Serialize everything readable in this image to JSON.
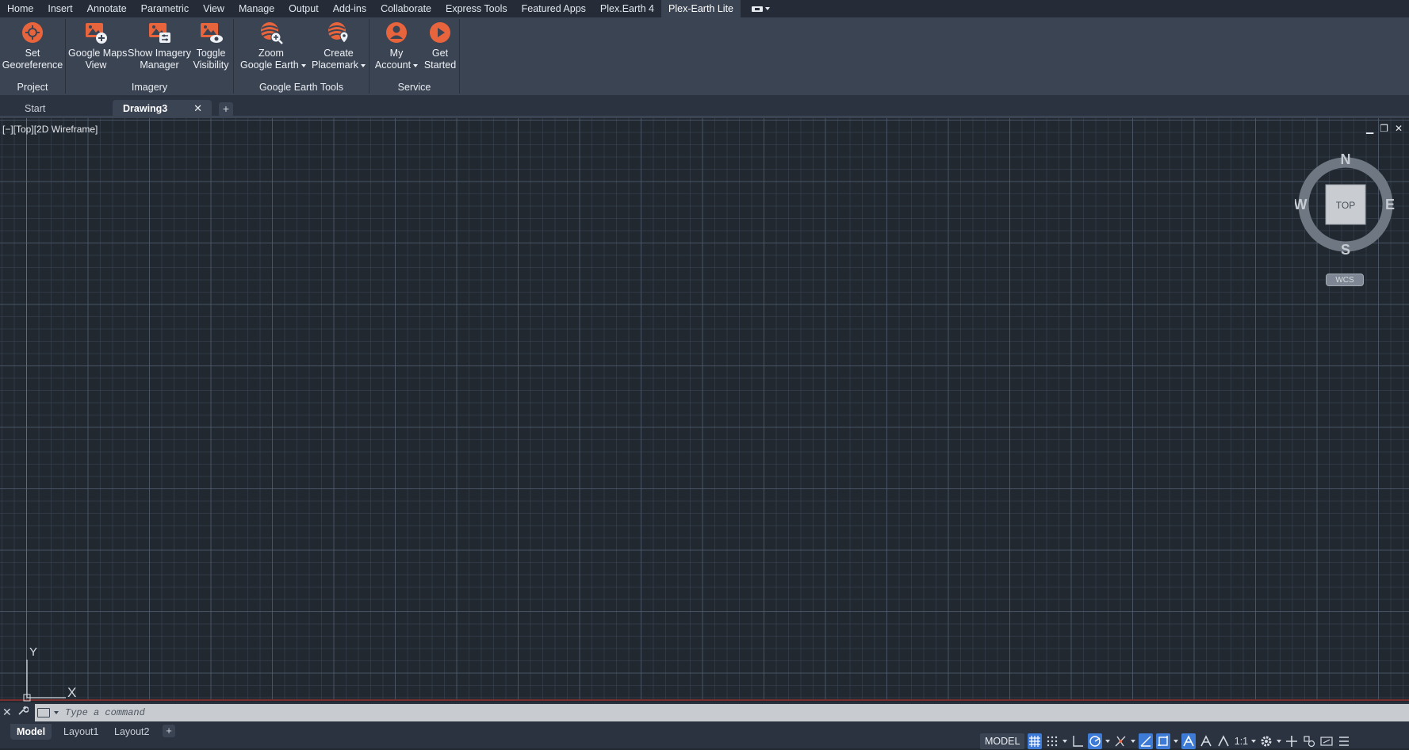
{
  "ribbon": {
    "tabs": [
      {
        "label": "Home",
        "active": false
      },
      {
        "label": "Insert",
        "active": false
      },
      {
        "label": "Annotate",
        "active": false
      },
      {
        "label": "Parametric",
        "active": false
      },
      {
        "label": "View",
        "active": false
      },
      {
        "label": "Manage",
        "active": false
      },
      {
        "label": "Output",
        "active": false
      },
      {
        "label": "Add-ins",
        "active": false
      },
      {
        "label": "Collaborate",
        "active": false
      },
      {
        "label": "Express Tools",
        "active": false
      },
      {
        "label": "Featured Apps",
        "active": false
      },
      {
        "label": "Plex.Earth 4",
        "active": false
      },
      {
        "label": "Plex-Earth Lite",
        "active": true
      }
    ],
    "groups": {
      "project": {
        "title": "Project",
        "set_georeference": "Set\nGeoreference"
      },
      "imagery": {
        "title": "Imagery",
        "google_maps_view": "Google Maps\nView",
        "show_imagery_manager": "Show Imagery\nManager",
        "toggle_visibility": "Toggle\nVisibility"
      },
      "google_earth_tools": {
        "title": "Google Earth Tools",
        "zoom_google_earth": "Zoom\nGoogle Earth",
        "create_placemark": "Create\nPlacemark"
      },
      "service": {
        "title": "Service",
        "my_account": "My\nAccount",
        "get_started": "Get\nStarted"
      }
    },
    "accent_color": "#e8643c"
  },
  "doc_tabs": {
    "start": "Start",
    "drawing": "Drawing3",
    "close_glyph": "✕",
    "new_tab_glyph": "+"
  },
  "viewport": {
    "view_label": "[−][Top][2D Wireframe]",
    "controls": {
      "minimize": "▁",
      "restore": "❐",
      "close": "✕"
    },
    "viewcube": {
      "north": "N",
      "south": "S",
      "east": "E",
      "west": "W",
      "face": "TOP",
      "wcs": "WCS"
    },
    "ucs": {
      "x": "X",
      "y": "Y"
    }
  },
  "command_line": {
    "placeholder": "Type a command",
    "close_glyph": "✕",
    "wrench_glyph": "🔧"
  },
  "status_bar": {
    "layout_tabs": [
      "Model",
      "Layout1",
      "Layout2"
    ],
    "new_layout_glyph": "+",
    "model_button": "MODEL",
    "scale": "1:1"
  }
}
